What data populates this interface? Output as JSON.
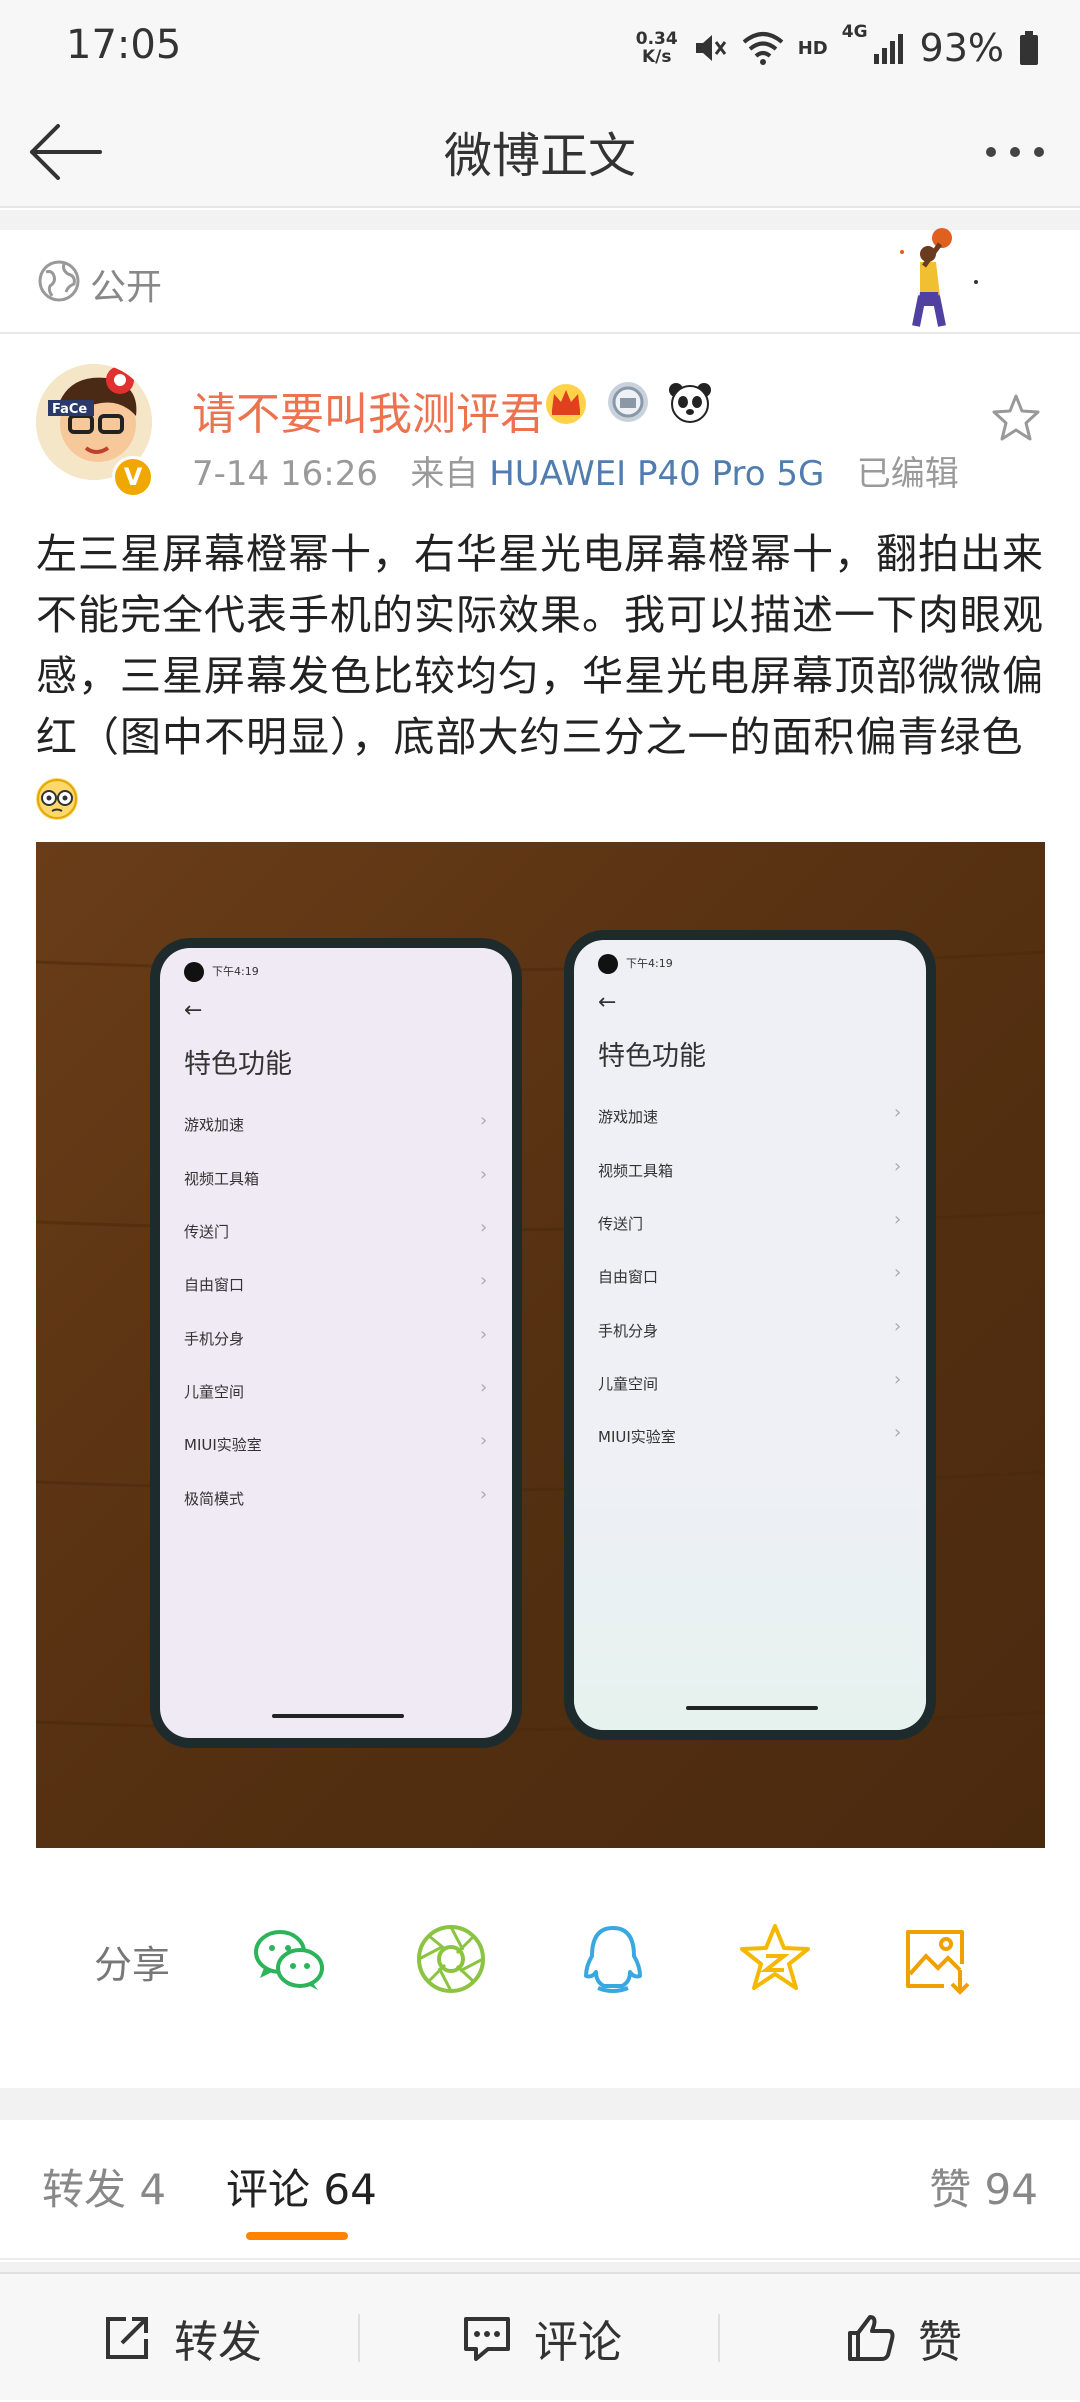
{
  "status_bar": {
    "time": "17:05",
    "net_speed_value": "0.34",
    "net_speed_unit": "K/s",
    "hd_label": "HD",
    "network_label": "4G",
    "battery": "93%"
  },
  "nav": {
    "title": "微博正文"
  },
  "visibility": {
    "label": "公开"
  },
  "post": {
    "author": "请不要叫我测评君",
    "timestamp": "7-14 16:26",
    "source_prefix": "来自",
    "device": "HUAWEI P40 Pro 5G",
    "edited": "已编辑",
    "verified_badge": "V",
    "avatar_text": "FaCe",
    "text": "左三星屏幕橙幂十，右华星光电屏幕橙幂十，翻拍出来不能完全代表手机的实际效果。我可以描述一下肉眼观感，三星屏幕发色比较均匀，华星光电屏幕顶部微微偏红（图中不明显），底部大约三分之一的面积偏青绿色"
  },
  "photo": {
    "left_phone": {
      "status_time": "下午4:19",
      "title": "特色功能",
      "items": [
        "游戏加速",
        "视频工具箱",
        "传送门",
        "自由窗口",
        "手机分身",
        "儿童空间",
        "MIUI实验室",
        "极简模式"
      ]
    },
    "right_phone": {
      "status_time": "下午4:19",
      "title": "特色功能",
      "items": [
        "游戏加速",
        "视频工具箱",
        "传送门",
        "自由窗口",
        "手机分身",
        "儿童空间",
        "MIUI实验室"
      ]
    }
  },
  "share": {
    "label": "分享",
    "targets": [
      "wechat-icon",
      "moments-icon",
      "qq-icon",
      "qzone-icon",
      "save-image-icon"
    ]
  },
  "tabs": {
    "repost": "转发 4",
    "comment": "评论 64",
    "like": "赞 94"
  },
  "bottom_bar": {
    "repost": "转发",
    "comment": "评论",
    "like": "赞"
  },
  "colors": {
    "accent": "#ff8200",
    "author": "#eb7350",
    "link": "#507daf"
  }
}
